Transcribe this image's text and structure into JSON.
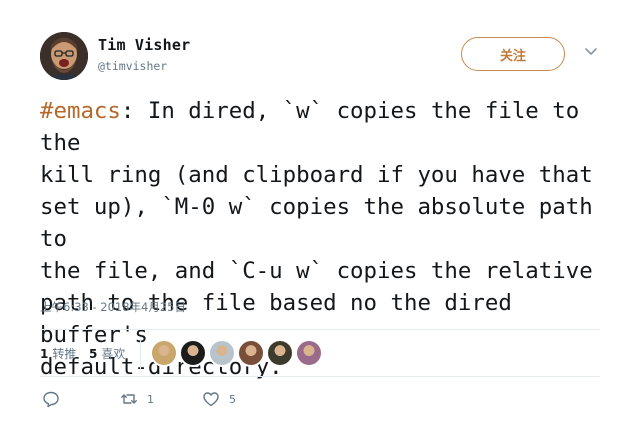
{
  "author": {
    "display_name": "Tim Visher",
    "handle": "@timvisher",
    "avatar_icon": "user-photo-avatar"
  },
  "follow_button": {
    "label": "关注",
    "color": "#c07a3c"
  },
  "menu_icon": "chevron-down-icon",
  "tweet": {
    "hashtag": "#emacs",
    "text": ": In dired, `w` copies the file to the\nkill ring (and clipboard if you have that\nset up), `M-0 w` copies the absolute path to\nthe file, and `C-u w` copies the relative\npath to the file based no the dired buffer's\ndefault-directory.",
    "hashtag_color": "#b4692b"
  },
  "timestamp": "上午6:33 - 2018年4月25日",
  "stats": {
    "retweets_count": "1",
    "retweets_label": "转推",
    "likes_count": "5",
    "likes_label": "喜欢"
  },
  "liker_avatars": [
    {
      "name": "liker-avatar-1",
      "color": "#c9a66b"
    },
    {
      "name": "liker-avatar-2",
      "color": "#1c1c1c"
    },
    {
      "name": "liker-avatar-3",
      "color": "#b8c4cc"
    },
    {
      "name": "liker-avatar-4",
      "color": "#7a4f3a"
    },
    {
      "name": "liker-avatar-5",
      "color": "#3d3a2e"
    },
    {
      "name": "liker-avatar-6",
      "color": "#9c6b8a"
    }
  ],
  "actions": {
    "reply_icon": "reply-icon",
    "reply_count": "",
    "retweet_icon": "retweet-icon",
    "retweet_count": "1",
    "like_icon": "heart-icon",
    "like_count": "5"
  }
}
